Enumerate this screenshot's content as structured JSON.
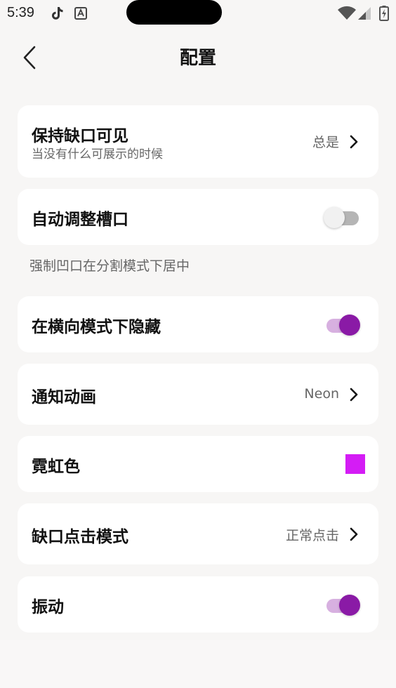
{
  "status_bar": {
    "time": "5:39"
  },
  "header": {
    "title": "配置",
    "back_icon": "chevron-left-icon"
  },
  "settings": {
    "keep_notch_visible": {
      "title": "保持缺口可见",
      "subtitle": "当没有什么可展示的时候",
      "value": "总是"
    },
    "auto_adjust_slot": {
      "title": "自动调整槽口",
      "enabled": false,
      "note": "强制凹口在分割模式下居中"
    },
    "hide_in_landscape": {
      "title": "在横向模式下隐藏",
      "enabled": true
    },
    "notification_animation": {
      "title": "通知动画",
      "value": "Neon"
    },
    "neon_color": {
      "title": "霓虹色",
      "color": "#d41cf5"
    },
    "notch_tap_mode": {
      "title": "缺口点击模式",
      "value": "正常点击"
    },
    "vibration": {
      "title": "振动",
      "enabled": true
    }
  },
  "colors": {
    "accent": "#8a1aa6",
    "accent_track": "#d7b0e0",
    "card": "#ffffff",
    "background": "#f7f6f5"
  }
}
